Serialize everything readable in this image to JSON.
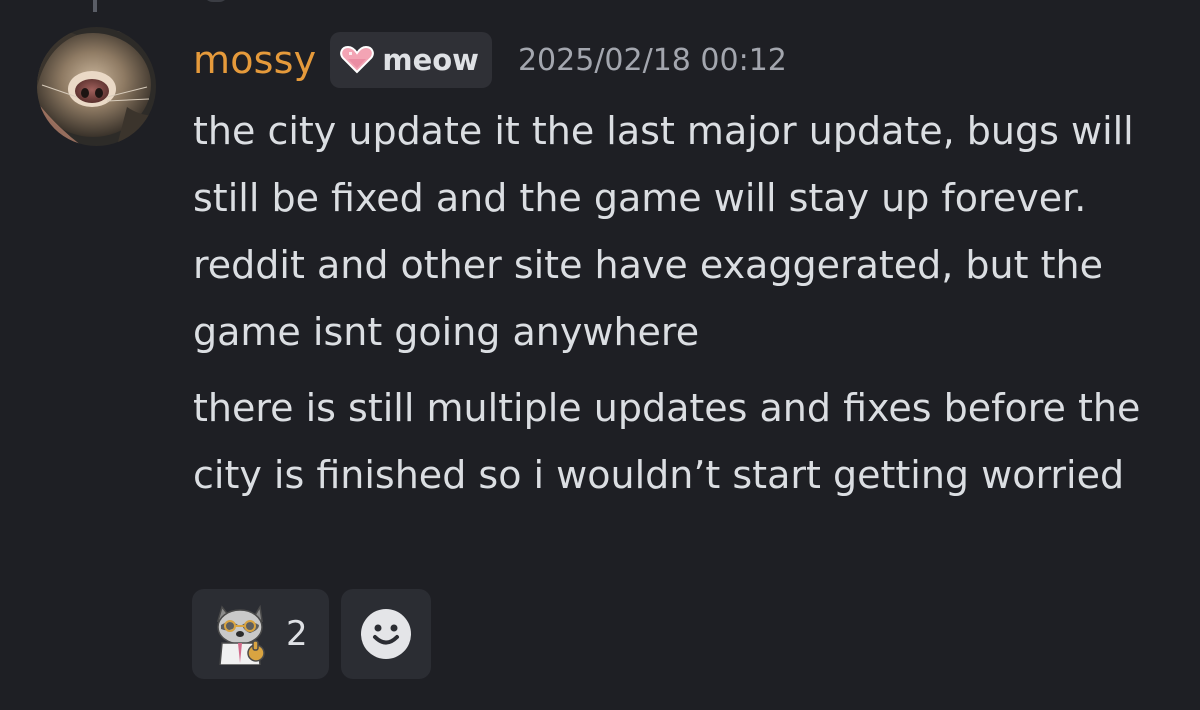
{
  "message": {
    "author": "mossy",
    "tag": {
      "label": "meow",
      "icon": "pink-heart-icon"
    },
    "timestamp": "2025/02/18 00:12",
    "paragraphs": [
      "the city update it the last major update, bugs will still be fixed and the game will stay up forever. reddit and other site have exaggerated, but the game isnt going anywhere",
      "there is still multiple updates and fixes before the city is finished so i wouldn’t start getting worried"
    ]
  },
  "reactions": [
    {
      "emoji": "raccoon-doctor-thumbs-up-emoji",
      "count": "2"
    }
  ],
  "add_reaction": {
    "icon": "smiley-face-icon"
  },
  "colors": {
    "background": "#1e1f24",
    "username": "#e59a3b",
    "text": "#dbdee2",
    "timestamp": "#a3a6ae",
    "chip": "#2f3036"
  }
}
